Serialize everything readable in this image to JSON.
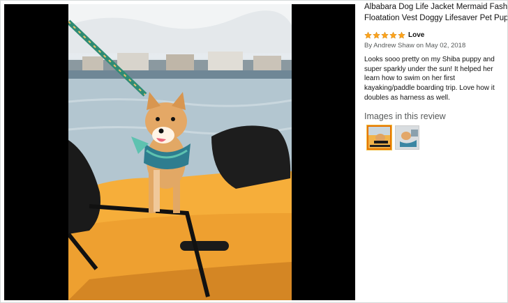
{
  "product": {
    "title_line1": "Albabara Dog Life Jacket Mermaid Fashion",
    "title_line2": "Floatation Vest Doggy Lifesaver Pet Puppy"
  },
  "review": {
    "stars": 5,
    "star_color": "#ffa41c",
    "headline": "Love",
    "byline": "By Andrew Shaw on May 02, 2018",
    "body": "Looks sooo pretty on my Shiba puppy and super sparkly under the sun! It helped her learn how to swim on her first kayaking/paddle boarding trip. Love how it doubles as harness as well."
  },
  "images_section": {
    "title": "Images in this review",
    "thumbnails": [
      {
        "icon": "dog-photo-thumbnail",
        "selected": true
      },
      {
        "icon": "dog-photo-thumbnail",
        "selected": false
      }
    ]
  },
  "colors": {
    "viewer_background": "#000000",
    "selected_thumbnail_border": "#e77600",
    "secondary_text": "#565959"
  }
}
